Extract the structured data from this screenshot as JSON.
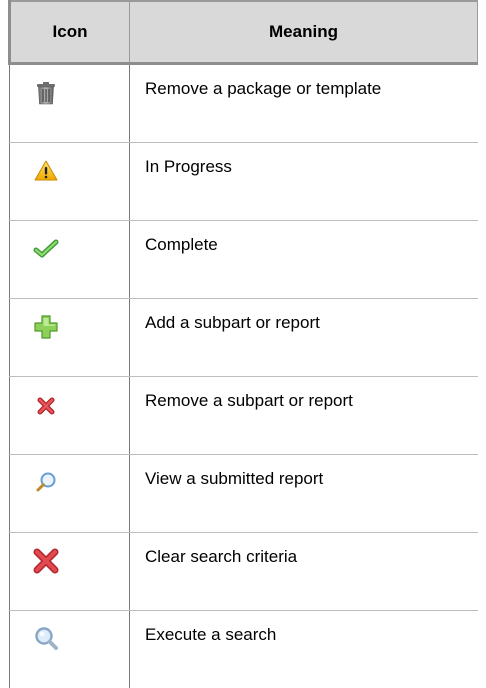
{
  "table": {
    "headers": {
      "icon": "Icon",
      "meaning": "Meaning"
    },
    "rows": [
      {
        "icon": "trash-can-icon",
        "meaning": "Remove a package or template"
      },
      {
        "icon": "warning-icon",
        "meaning": "In Progress"
      },
      {
        "icon": "checkmark-icon",
        "meaning": "Complete"
      },
      {
        "icon": "green-plus-icon",
        "meaning": "Add a subpart or report"
      },
      {
        "icon": "small-red-x-icon",
        "meaning": "Remove a subpart or report"
      },
      {
        "icon": "small-magnifier-icon",
        "meaning": "View a submitted report"
      },
      {
        "icon": "large-red-x-icon",
        "meaning": "Clear search criteria"
      },
      {
        "icon": "large-magnifier-icon",
        "meaning": "Execute a search"
      }
    ]
  },
  "colors": {
    "header_bg": "#d9d9d9",
    "plus_green": "#7bc043",
    "x_red": "#d8333a",
    "warning_yellow": "#f5c518",
    "check_green": "#5cb84a"
  }
}
